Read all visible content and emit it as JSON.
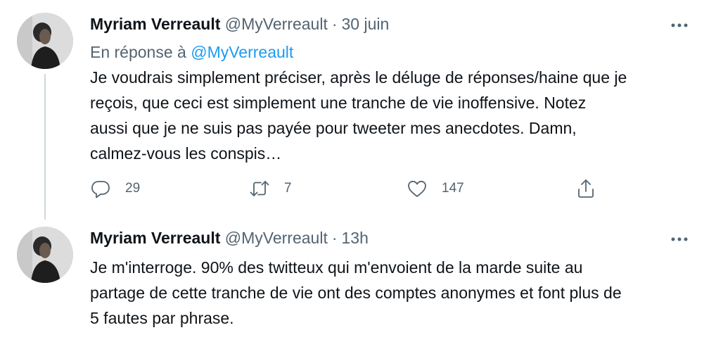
{
  "tweets": [
    {
      "author_name": "Myriam Verreault",
      "author_handle": "@MyVerreault",
      "separator": "·",
      "timestamp": "30 juin",
      "reply_prefix": "En réponse à",
      "reply_handle": "@MyVerreault",
      "body_lines": [
        "Je voudrais simplement préciser, après le déluge de réponses/haine que je",
        "reçois, que ceci est simplement une tranche de vie inoffensive. Notez",
        "aussi que je ne suis pas payée pour tweeter mes anecdotes. Damn,",
        "calmez-vous les conspis…"
      ],
      "actions": {
        "reply_count": "29",
        "retweet_count": "7",
        "like_count": "147"
      }
    },
    {
      "author_name": "Myriam Verreault",
      "author_handle": "@MyVerreault",
      "separator": "·",
      "timestamp": "13h",
      "body_lines": [
        "Je m'interroge. 90% des twitteux qui m'envoient de la marde suite au",
        "partage de cette tranche de vie ont des comptes anonymes et font plus de",
        "5 fautes par phrase."
      ]
    }
  ],
  "colors": {
    "text_primary": "#0f1419",
    "text_secondary": "#536471",
    "link": "#1d9bf0",
    "thread_line": "#cfd9de"
  },
  "icons": [
    "reply-icon",
    "retweet-icon",
    "like-icon",
    "share-icon",
    "more-icon"
  ]
}
